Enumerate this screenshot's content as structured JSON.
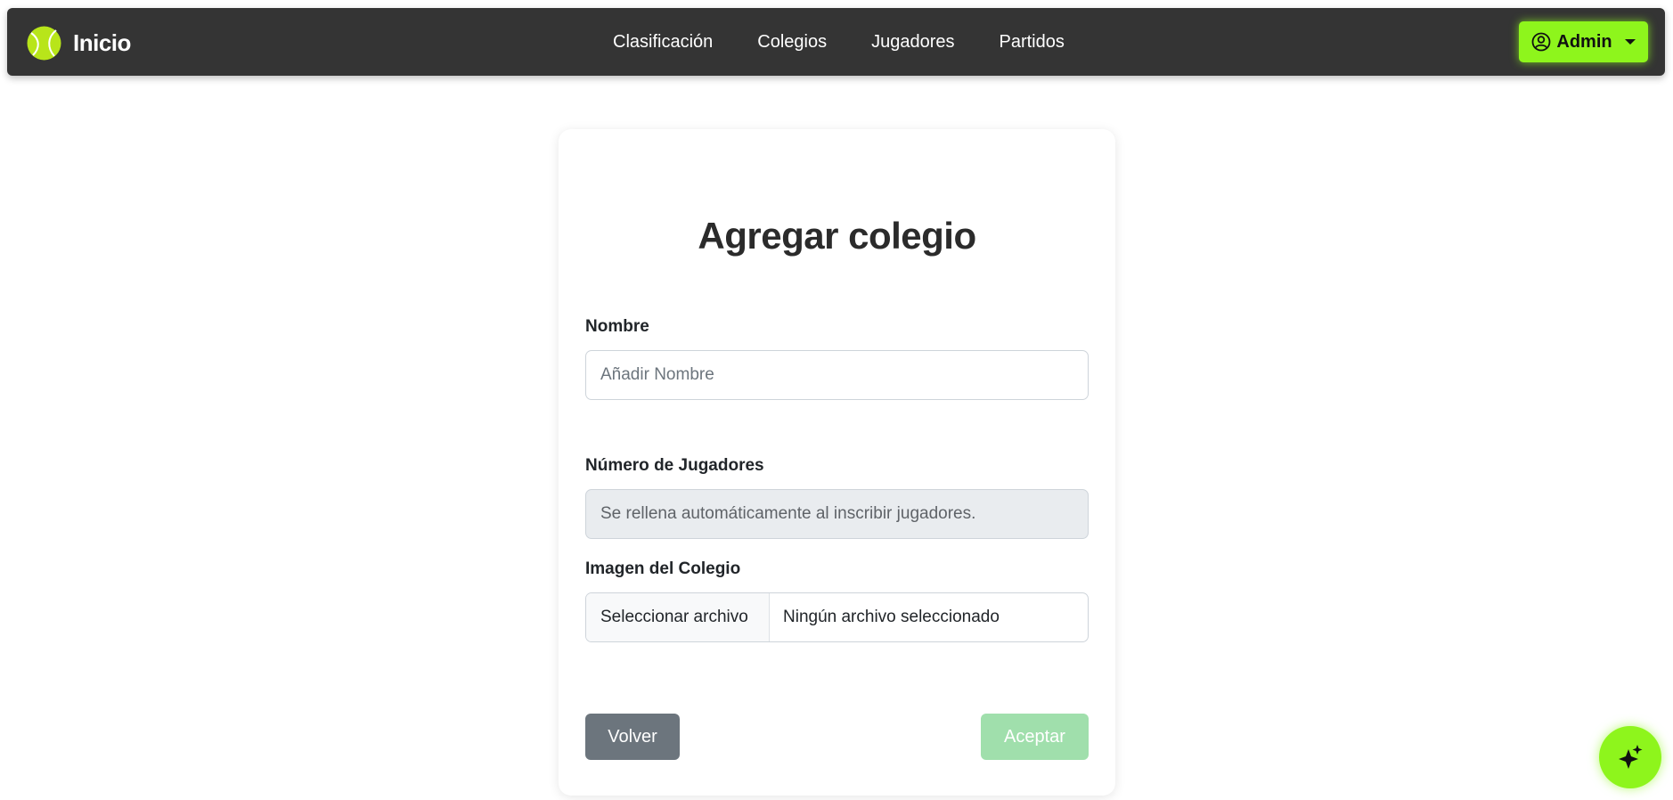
{
  "navbar": {
    "brand_label": "Inicio",
    "brand_icon": "tennis-ball-icon",
    "links": [
      {
        "label": "Clasificación"
      },
      {
        "label": "Colegios"
      },
      {
        "label": "Jugadores"
      },
      {
        "label": "Partidos"
      }
    ],
    "user_menu": {
      "label": "Admin",
      "icon": "user-circle-icon"
    }
  },
  "form": {
    "title": "Agregar colegio",
    "name_field": {
      "label": "Nombre",
      "placeholder": "Añadir Nombre",
      "value": ""
    },
    "players_field": {
      "label": "Número de Jugadores",
      "placeholder": "Se rellena automáticamente al inscribir jugadores.",
      "value": ""
    },
    "image_field": {
      "label": "Imagen del Colegio",
      "button_label": "Seleccionar archivo",
      "file_status": "Ningún archivo seleccionado"
    },
    "back_button": "Volver",
    "accept_button": "Aceptar"
  },
  "floating_action": {
    "icon": "sparkles-icon"
  },
  "colors": {
    "navbar_bg": "#343434",
    "accent_green": "#8ef51c",
    "back_button": "#6c757d",
    "accept_button_disabled": "#a0dfac"
  }
}
